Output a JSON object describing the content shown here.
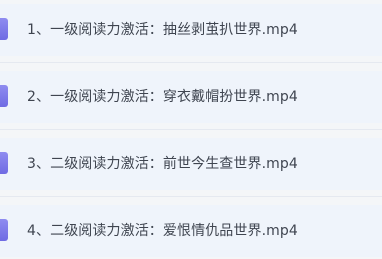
{
  "files": [
    {
      "label": "1、一级阅读力激活：抽丝剥茧扒世界.mp4",
      "icon": "video-file-icon"
    },
    {
      "label": "2、一级阅读力激活：穿衣戴帽扮世界.mp4",
      "icon": "video-file-icon"
    },
    {
      "label": "3、二级阅读力激活：前世今生查世界.mp4",
      "icon": "video-file-icon"
    },
    {
      "label": "4、二级阅读力激活：爱恨情仇品世界.mp4",
      "icon": "video-file-icon"
    }
  ],
  "colors": {
    "background": "#f4f6f8",
    "row_background": "#eff4fb",
    "icon_accent": "#7f7cea",
    "text": "#3f4550"
  }
}
